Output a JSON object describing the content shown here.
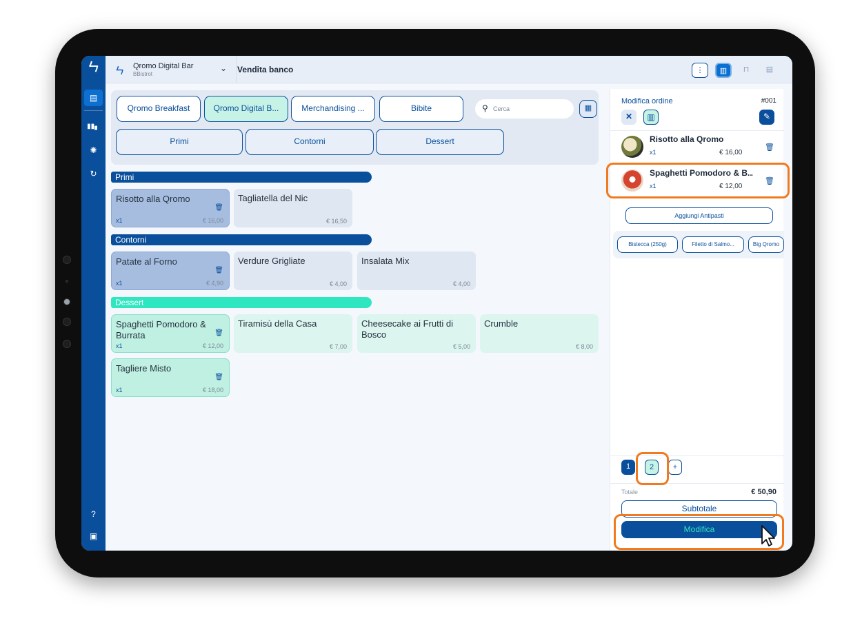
{
  "header": {
    "store_name": "Qromo Digital Bar",
    "store_sub": "BBistrot",
    "mode_title": "Vendita banco"
  },
  "categories": {
    "main": [
      "Qromo Breakfast",
      "Qromo Digital B...",
      "Merchandising ...",
      "Bibite"
    ],
    "selected_main": "Qromo Digital B...",
    "sub": [
      "Primi",
      "Contorni",
      "Dessert"
    ]
  },
  "search": {
    "placeholder": "Cerca"
  },
  "sections": {
    "primi": {
      "title": "Primi",
      "color": "#0a4f9c",
      "items": [
        {
          "name": "Risotto alla Qromo",
          "qty": "x1",
          "price": "€ 16,00"
        },
        {
          "name": "Tagliatella del Nic",
          "price": "€ 16,50"
        }
      ]
    },
    "contorni": {
      "title": "Contorni",
      "color": "#0a4f9c",
      "items": [
        {
          "name": "Patate al Forno",
          "qty": "x1",
          "price": "€ 4,90"
        },
        {
          "name": "Verdure Grigliate",
          "price": "€ 4,00"
        },
        {
          "name": "Insalata Mix",
          "price": "€ 4,00"
        }
      ]
    },
    "dessert": {
      "title": "Dessert",
      "color": "#2ee6bf",
      "items": [
        {
          "name": "Spaghetti Pomodoro & Burrata",
          "qty": "x1",
          "price": "€ 12,00"
        },
        {
          "name": "Tiramisù della Casa",
          "price": "€ 7,00"
        },
        {
          "name": "Cheesecake ai Frutti di Bosco",
          "price": "€ 5,00"
        },
        {
          "name": "Crumble",
          "price": "€ 8,00"
        },
        {
          "name": "Tagliere Misto",
          "qty": "x1",
          "price": "€ 18,00"
        }
      ]
    }
  },
  "order": {
    "title": "Modifica ordine",
    "number": "#001",
    "items": [
      {
        "name": "Risotto alla Qromo",
        "qty": "x1",
        "price": "€ 16,00"
      },
      {
        "name": "Spaghetti Pomodoro & B...",
        "qty": "x1",
        "price": "€ 12,00"
      }
    ],
    "add_button": "Aggiungi Antipasti",
    "suggestions": [
      "Bistecca (250g)",
      "Filetto di Salmo...",
      "Big Qromo"
    ],
    "pages": [
      "1",
      "2",
      "+"
    ],
    "total_label": "Totale",
    "total_value": "€ 50,90",
    "subtotal_button": "Subtotale",
    "modify_button": "Modifica"
  },
  "colors": {
    "brand": "#0a4f9c",
    "mint": "#2ee6bf",
    "highlight": "#f17a1f"
  },
  "icons": [
    "logo-icon",
    "receipt-icon",
    "chart-icon",
    "settings-icon",
    "sync-icon",
    "help-icon",
    "monitor-icon",
    "chevron-down-icon",
    "more-icon",
    "book-icon",
    "table-icon",
    "document-icon",
    "search-icon",
    "calculator-icon",
    "close-icon",
    "edit-icon",
    "trash-icon",
    "cursor-icon"
  ]
}
